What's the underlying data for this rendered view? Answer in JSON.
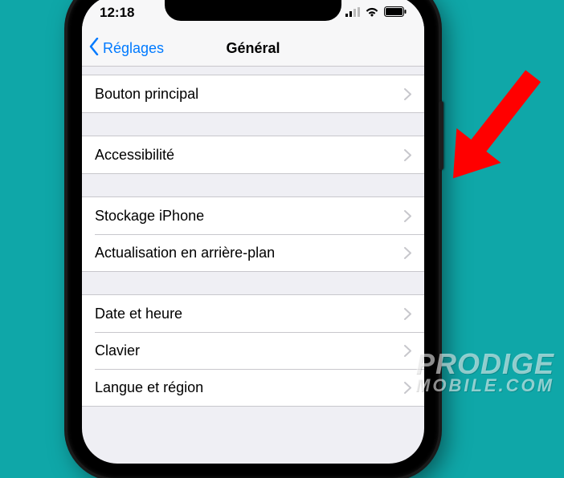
{
  "status": {
    "time": "12:18"
  },
  "nav": {
    "back": "Réglages",
    "title": "Général"
  },
  "groups": [
    [
      "Bouton principal"
    ],
    [
      "Accessibilité"
    ],
    [
      "Stockage iPhone",
      "Actualisation en arrière-plan"
    ],
    [
      "Date et heure",
      "Clavier",
      "Langue et région"
    ]
  ],
  "watermark": {
    "line1": "PRODIGE",
    "line2": "MOBILE.COM"
  }
}
